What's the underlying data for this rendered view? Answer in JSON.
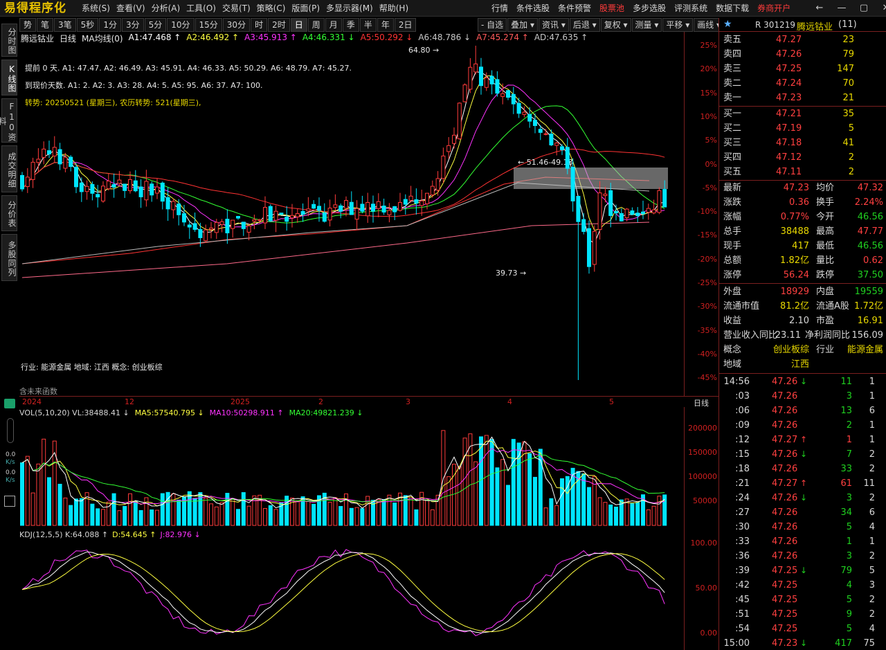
{
  "app": {
    "logo": "易得程序化",
    "menus": [
      "系统(S)",
      "查看(V)",
      "分析(A)",
      "工具(O)",
      "交易(T)",
      "策略(C)",
      "版面(P)",
      "多显示器(M)",
      "帮助(H)"
    ],
    "right_menus": [
      "行情",
      "条件选股",
      "条件预警",
      "股票池",
      "多步选股",
      "评测系统",
      "数据下载",
      "券商开户"
    ],
    "window_controls": [
      "←",
      "—",
      "▢",
      "✕"
    ]
  },
  "colors": {
    "up": "#ff3b3b",
    "down": "#00e5ff",
    "gold": "#e8c200",
    "green": "#20d020",
    "ma_white": "#ffffff",
    "ma_yellow": "#ffff40",
    "ma_magenta": "#ff33ff",
    "ma_green": "#33ff33"
  },
  "left_tabs": [
    "分时图",
    "K线图",
    "F10资料",
    "成交明细",
    "分价表",
    "多股同列"
  ],
  "toolbar": [
    "势",
    "笔",
    "3笔",
    "5秒",
    "1分",
    "3分",
    "5分",
    "10分",
    "15分",
    "30分",
    "时",
    "2时",
    "日",
    "周",
    "月",
    "季",
    "半",
    "年",
    "2日"
  ],
  "toolbar_right": [
    "- 自选",
    "叠加",
    "资讯",
    "后退",
    "复权",
    "测量",
    "平移",
    "画线"
  ],
  "chart_title": {
    "name": "腾远钴业",
    "period": "日线",
    "indicator": "MA均线(0)",
    "values": [
      "A1:47.468 ↑",
      "A2:46.492 ↑",
      "A3:45.913 ↑",
      "A4:46.331 ↓",
      "A5:50.292 ↓",
      "A6:48.786 ↓",
      "A7:45.274 ↑",
      "AD:47.635 ↑"
    ]
  },
  "info_lines": [
    "提前 0 天.  A1: 47.47.   A2: 46.49.   A3: 45.91.   A4: 46.33.   A5: 50.29.   A6: 48.79.   A7: 45.27.",
    "到现价天数.  A1: 2.   A2: 3.   A3: 28.   A4: 5.   A5: 95.   A6: 37.   A7: 100.",
    "转势: 20250521 (星期三),  农历转势:   521(星期三),"
  ],
  "industry_line": "行业: 能源金属 地域: 江西    概念: 创业板综",
  "no_future": "含未来函数",
  "annotations": {
    "high": "64.80",
    "low": "39.73",
    "range": "51.46-49.13"
  },
  "pct_axis": [
    "25%",
    "20%",
    "15%",
    "10%",
    "5%",
    "0%",
    "-5%",
    "-10%",
    "-15%",
    "-20%",
    "-25%",
    "-30%",
    "-35%",
    "-40%",
    "-45%"
  ],
  "date_axis": [
    "2024",
    "12",
    "2025",
    "2",
    "3",
    "4",
    "5"
  ],
  "date_axis_label": "日线",
  "vol_header": [
    "VOL(5,10,20) VL:38488.41 ↓",
    "MA5:57540.795 ↓",
    "MA10:50298.911 ↑",
    "MA20:49821.239 ↓"
  ],
  "vol_axis": [
    "200000",
    "150000",
    "100000",
    "50000"
  ],
  "kdj_header": [
    "KDJ(12,5,5) K:64.088 ↑",
    "D:54.645 ↑",
    "J:82.976 ↓"
  ],
  "kdj_axis": [
    "100.00",
    "50.00",
    "0.00"
  ],
  "side_icons": [
    "0.0",
    "K/s",
    "0.0",
    "K/s"
  ],
  "stock": {
    "code": "R 301219",
    "name": "腾远钴业",
    "count": "(11)"
  },
  "orders_sell": [
    [
      "卖五",
      "47.27",
      "23"
    ],
    [
      "卖四",
      "47.26",
      "79"
    ],
    [
      "卖三",
      "47.25",
      "147"
    ],
    [
      "卖二",
      "47.24",
      "70"
    ],
    [
      "卖一",
      "47.23",
      "21"
    ]
  ],
  "orders_buy": [
    [
      "买一",
      "47.21",
      "35"
    ],
    [
      "买二",
      "47.19",
      "5"
    ],
    [
      "买三",
      "47.18",
      "41"
    ],
    [
      "买四",
      "47.12",
      "2"
    ],
    [
      "买五",
      "47.11",
      "2"
    ]
  ],
  "quote": [
    [
      "最新",
      "47.23",
      "均价",
      "47.32"
    ],
    [
      "涨跌",
      "0.36",
      "换手",
      "2.24%"
    ],
    [
      "涨幅",
      "0.77%",
      "今开",
      "46.56"
    ],
    [
      "总手",
      "38488",
      "最高",
      "47.77"
    ],
    [
      "现手",
      "417",
      "最低",
      "46.56"
    ],
    [
      "总额",
      "1.82亿",
      "量比",
      "0.62"
    ],
    [
      "涨停",
      "56.24",
      "跌停",
      "37.50"
    ]
  ],
  "quote2": [
    [
      "外盘",
      "18929",
      "内盘",
      "19559"
    ],
    [
      "流通市值",
      "81.2亿",
      "流通A股",
      "1.72亿"
    ],
    [
      "收益",
      "2.10",
      "市盈",
      "16.91"
    ],
    [
      "营业收入同比",
      "23.11",
      "净利润同比",
      "156.09"
    ],
    [
      "概念",
      "创业板综",
      "行业",
      "能源金属"
    ],
    [
      "地域",
      "江西",
      "",
      ""
    ]
  ],
  "ticks": [
    [
      "14:56",
      "47.26",
      "↓",
      "11",
      "1"
    ],
    [
      ":03",
      "47.26",
      "",
      "3",
      "1"
    ],
    [
      ":06",
      "47.26",
      "",
      "13",
      "6"
    ],
    [
      ":09",
      "47.26",
      "",
      "2",
      "1"
    ],
    [
      ":12",
      "47.27",
      "↑",
      "1",
      "1"
    ],
    [
      ":15",
      "47.26",
      "↓",
      "7",
      "2"
    ],
    [
      ":18",
      "47.26",
      "",
      "33",
      "2"
    ],
    [
      ":21",
      "47.27",
      "↑",
      "61",
      "11"
    ],
    [
      ":24",
      "47.26",
      "↓",
      "3",
      "2"
    ],
    [
      ":27",
      "47.26",
      "",
      "34",
      "6"
    ],
    [
      ":30",
      "47.26",
      "",
      "5",
      "4"
    ],
    [
      ":33",
      "47.26",
      "",
      "1",
      "1"
    ],
    [
      ":36",
      "47.26",
      "",
      "3",
      "2"
    ],
    [
      ":39",
      "47.25",
      "↓",
      "79",
      "5"
    ],
    [
      ":42",
      "47.25",
      "",
      "4",
      "3"
    ],
    [
      ":45",
      "47.25",
      "",
      "5",
      "2"
    ],
    [
      ":51",
      "47.25",
      "",
      "9",
      "2"
    ],
    [
      ":54",
      "47.25",
      "",
      "5",
      "4"
    ],
    [
      "15:00",
      "47.23",
      "↓",
      "417",
      "75"
    ]
  ],
  "chart_data": {
    "type": "candlestick",
    "price_axis_pct": {
      "min": -45,
      "max": 25
    },
    "base_price": 46.87,
    "high_label": 64.8,
    "low_label": 39.73,
    "vol_axis": {
      "min": 0,
      "max": 200000
    },
    "kdj_axis": {
      "min": 0,
      "max": 100
    }
  }
}
